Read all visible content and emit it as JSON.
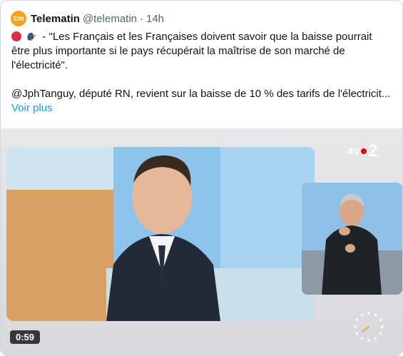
{
  "post": {
    "author_name": "Telematin",
    "author_handle": "@telematin",
    "separator": "·",
    "timestamp": "14h",
    "avatar_text": "t:m",
    "line1_suffix": " - \"Les Français et les Françaises doivent savoir que la baisse pourrait",
    "line2": "être plus importante si le pays récupérait la maîtrise de son marché de",
    "line3": "l'électricité\".",
    "line4": "@JphTanguy, député RN, revient sur la baisse de 10 % des tarifs de l'électricit...",
    "see_more": "Voir plus"
  },
  "media": {
    "duration": "0:59",
    "channel_logo_text": "4V",
    "channel_logo_number": "2"
  },
  "colors": {
    "accent": "#1d9bf0",
    "avatar": "#f7a21b",
    "red_emoji": "#dd2e44",
    "logo_red": "#e2001a"
  },
  "icons": [
    "red-circle-icon",
    "speaking-head-icon",
    "loading-clock-icon"
  ]
}
